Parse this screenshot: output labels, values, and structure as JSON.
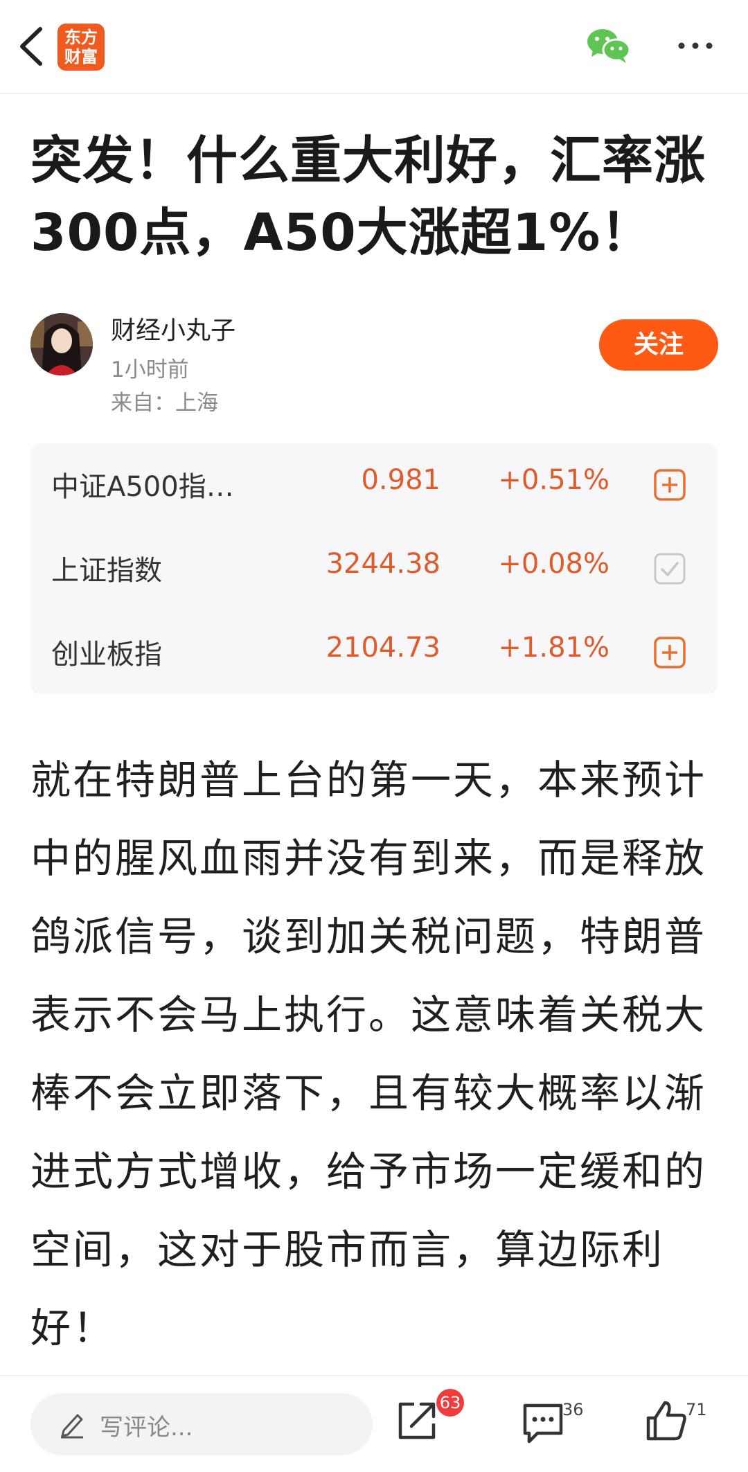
{
  "header": {
    "logo_line1": "东方",
    "logo_line2": "财富"
  },
  "article": {
    "title": "突发！什么重大利好，汇率涨300点，A50大涨超1%！",
    "author": "财经小丸子",
    "time": "1小时前",
    "origin": "来自：上海",
    "follow_label": "关注",
    "body": "就在特朗普上台的第一天，本来预计中的腥风血雨并没有到来，而是释放鸽派信号，谈到加关税问题，特朗普表示不会马上执行。这意味着关税大棒不会立即落下，且有较大概率以渐进式方式增收，给予市场一定缓和的空间，这对于股市而言，算边际利好！"
  },
  "stocks": [
    {
      "name": "中证A500指…",
      "price": "0.981",
      "change": "+0.51%",
      "action_icon": "add-icon"
    },
    {
      "name": "上证指数",
      "price": "3244.38",
      "change": "+0.08%",
      "action_icon": "check-icon"
    },
    {
      "name": "创业板指",
      "price": "2104.73",
      "change": "+1.81%",
      "action_icon": "add-icon"
    }
  ],
  "bottom": {
    "comment_placeholder": "写评论...",
    "share_count": "63",
    "comment_count": "36",
    "like_count": "71"
  },
  "colors": {
    "brand": "#f05a1e",
    "follow": "#ff5a14",
    "rise": "#e05a2a",
    "badge": "#f03c3c"
  }
}
